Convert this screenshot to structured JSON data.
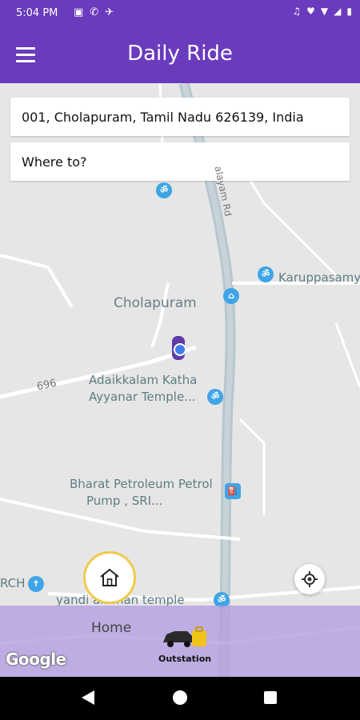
{
  "status_bar": {
    "time": "5:04 PM",
    "left_icons": [
      "image-icon",
      "wifi-call-icon",
      "plane-icon"
    ],
    "right_icons": [
      "headset-icon",
      "heart-icon",
      "wifi-icon",
      "signal-icon",
      "battery-icon"
    ]
  },
  "app_bar": {
    "title": "Daily Ride",
    "menu_icon": "hamburger-menu-icon"
  },
  "search": {
    "pickup_value": "001, Cholapuram, Tamil Nadu 626139, India",
    "destination_placeholder": "Where to?"
  },
  "map": {
    "places": {
      "cholapuram": "Cholapuram",
      "karuppasamy": "Karuppasamy",
      "adaikkalam_line1": "Adaikkalam Katha",
      "adaikkalam_line2": "Ayyanar Temple...",
      "bharat_line1": "Bharat Petroleum Petrol",
      "bharat_line2": "Pump , SRI...",
      "amman_temple": "yandi amman temple",
      "rch": "RCH",
      "road_696": "696",
      "road_name": "alayam Rd"
    },
    "watermark": "Google"
  },
  "bottom": {
    "home_label": "Home",
    "outstation_label": "Outstation"
  },
  "colors": {
    "primary": "#6a3bbd",
    "band": "#b4a0e1",
    "accent_ring": "#f2c94c",
    "poi_blue": "#3fa5e6"
  }
}
